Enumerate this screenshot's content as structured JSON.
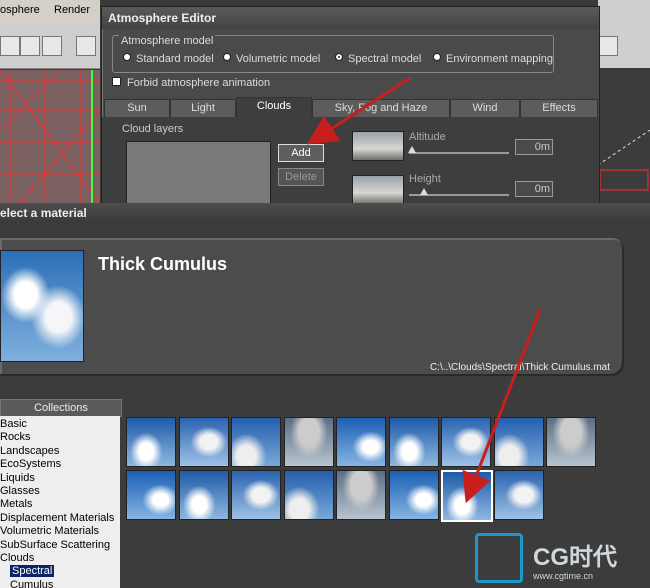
{
  "app": {
    "menu": [
      "osphere",
      "Render"
    ]
  },
  "atmosphere_editor": {
    "title": "Atmosphere Editor",
    "model_group_label": "Atmosphere model",
    "models": [
      {
        "label": "Standard model",
        "selected": false
      },
      {
        "label": "Volumetric model",
        "selected": false
      },
      {
        "label": "Spectral model",
        "selected": true
      },
      {
        "label": "Environment mapping",
        "selected": false
      }
    ],
    "forbid_label": "Forbid atmosphere animation",
    "tabs": [
      {
        "label": "Sun",
        "active": false
      },
      {
        "label": "Light",
        "active": false
      },
      {
        "label": "Clouds",
        "active": true
      },
      {
        "label": "Sky, Fog and Haze",
        "active": false
      },
      {
        "label": "Wind",
        "active": false
      },
      {
        "label": "Effects",
        "active": false
      }
    ],
    "cloud_layers_label": "Cloud layers",
    "add_label": "Add",
    "delete_label": "Delete",
    "altitude": {
      "label": "Altitude",
      "value": "0m"
    },
    "height": {
      "label": "Height",
      "value": "0m"
    }
  },
  "material_dialog": {
    "title": "elect a material",
    "material_name": "Thick Cumulus",
    "path": "C:\\..\\Clouds\\Spectral\\Thick Cumulus.mat",
    "collections_header": "Collections",
    "collections": [
      {
        "label": "Basic",
        "indent": false,
        "selected": false
      },
      {
        "label": "Rocks",
        "indent": false,
        "selected": false
      },
      {
        "label": "Landscapes",
        "indent": false,
        "selected": false
      },
      {
        "label": "EcoSystems",
        "indent": false,
        "selected": false
      },
      {
        "label": "Liquids",
        "indent": false,
        "selected": false
      },
      {
        "label": "Glasses",
        "indent": false,
        "selected": false
      },
      {
        "label": "Metals",
        "indent": false,
        "selected": false
      },
      {
        "label": "Displacement Materials",
        "indent": false,
        "selected": false
      },
      {
        "label": "Volumetric Materials",
        "indent": false,
        "selected": false
      },
      {
        "label": "SubSurface Scattering",
        "indent": false,
        "selected": false
      },
      {
        "label": "Clouds",
        "indent": false,
        "selected": false
      },
      {
        "label": "Spectral",
        "indent": true,
        "selected": true
      },
      {
        "label": "Cumulus",
        "indent": true,
        "selected": false
      }
    ],
    "tiles_row1": 9,
    "tiles_row2": 8,
    "selected_tile": 15
  },
  "watermark": {
    "brand": "CG时代",
    "url": "www.cgtime.cn"
  },
  "colors": {
    "arrow": "#c81e1e",
    "selection": "#0a246a",
    "logo": "#1b97c9"
  }
}
